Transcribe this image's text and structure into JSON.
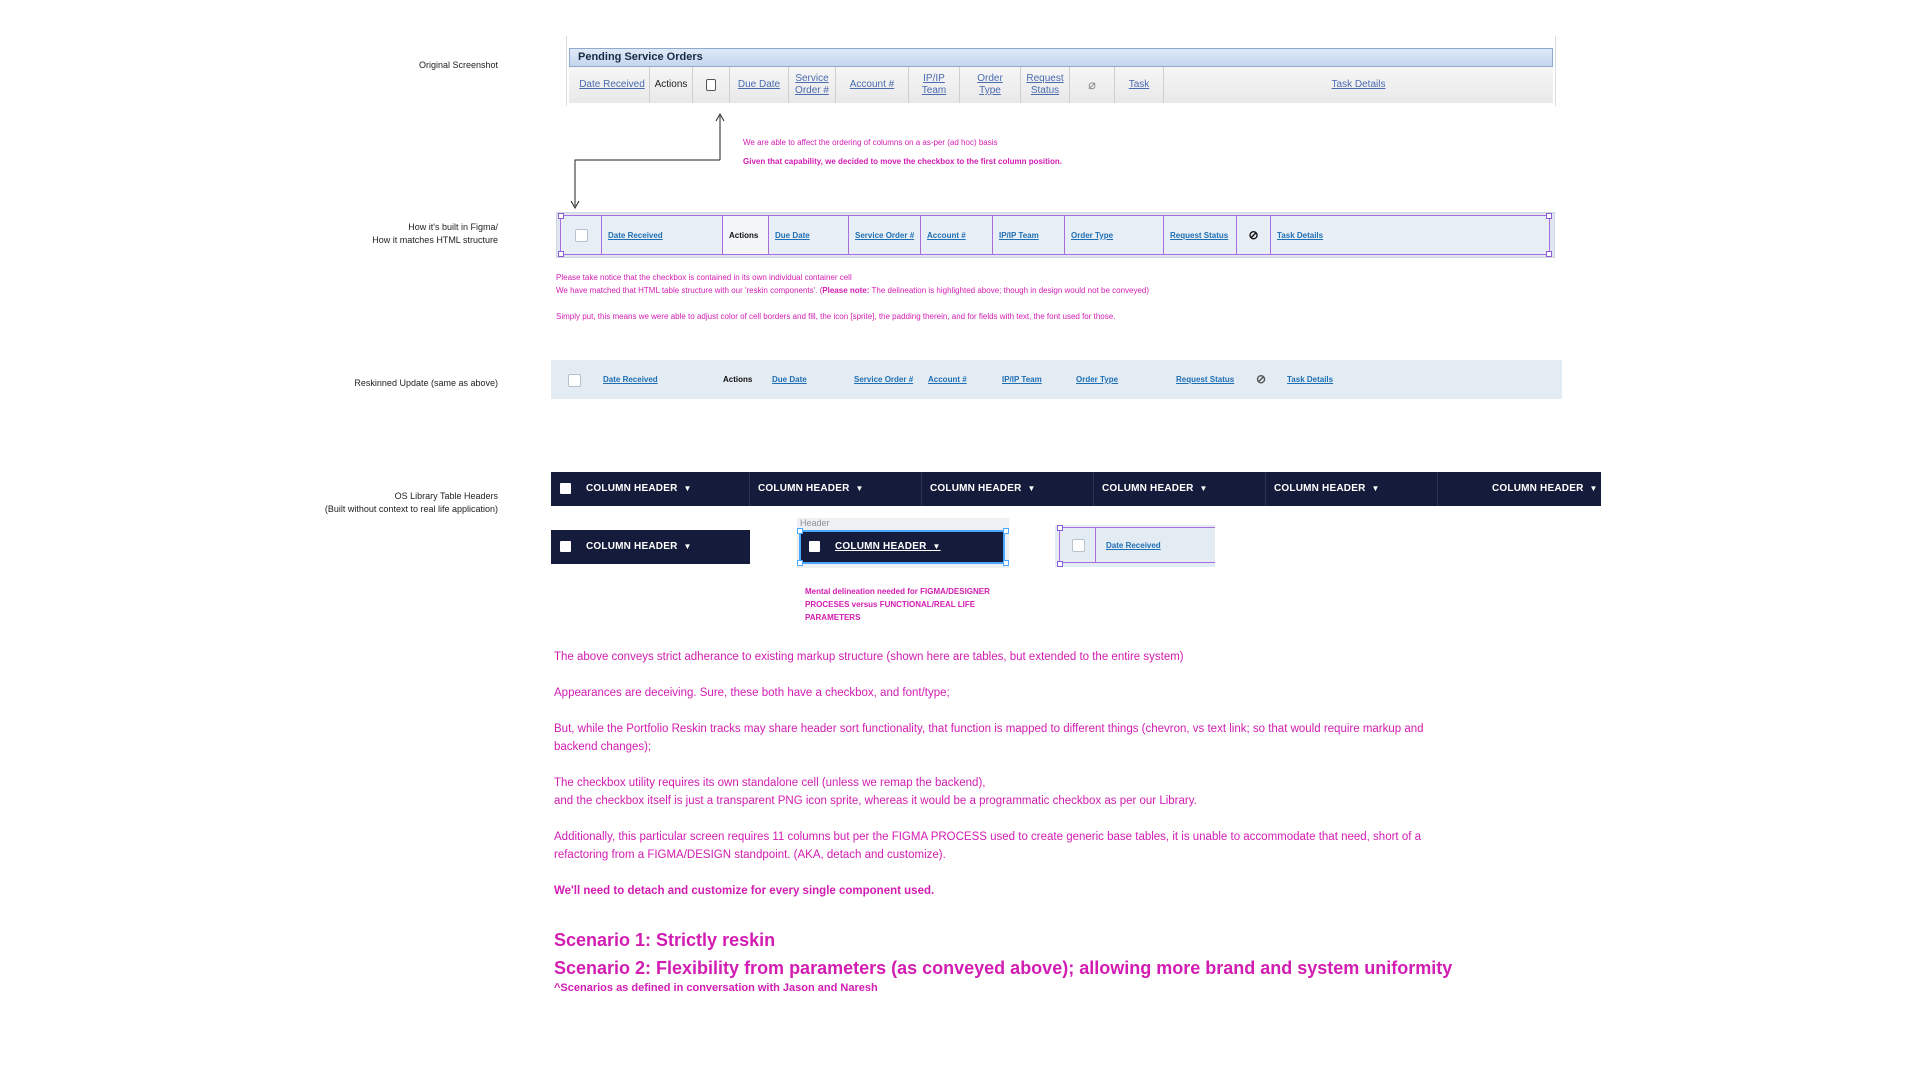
{
  "labels": {
    "original": "Original Screenshot",
    "figma_line1": "How it's built in Figma/",
    "figma_line2": "How it matches HTML structure",
    "reskinned": "Reskinned Update (same as above)",
    "os_line1": "OS Library Table Headers",
    "os_line2": "(Built without context to real life application)"
  },
  "original": {
    "title": "Pending Service Orders",
    "columns": [
      {
        "line1": "Date Received",
        "line2": ""
      },
      {
        "line1": "Actions",
        "line2": ""
      },
      {
        "line1": "",
        "line2": ""
      },
      {
        "line1": "Due Date",
        "line2": ""
      },
      {
        "line1": "Service",
        "line2": "Order #"
      },
      {
        "line1": "Account #",
        "line2": ""
      },
      {
        "line1": "IP/IP",
        "line2": "Team"
      },
      {
        "line1": "Order",
        "line2": "Type"
      },
      {
        "line1": "Request",
        "line2": "Status"
      },
      {
        "line1": "",
        "line2": ""
      },
      {
        "line1": "Task",
        "line2": ""
      },
      {
        "line1": "Task Details",
        "line2": ""
      }
    ]
  },
  "annotations": {
    "reorder_1": "We are able to affect the ordering of columns on a as-per (ad hoc) basis",
    "reorder_2": "Given that capability, we decided to move the checkbox to the first column position.",
    "notice_1": "Please take notice that the checkbox is contained in its own individual container cell",
    "notice_2a": "We have matched that HTML table structure with our 'reskin components'.  (",
    "notice_2b": "Please note:",
    "notice_2c": " The delineation is highlighted above; though in design would not be conveyed)",
    "notice_3": "Simply put, this means we were able to adjust color of cell borders and fill, the icon [sprite], the padding therein, and for fields with text, the font used for those.",
    "mental_1": "Mental delineation needed for FIGMA/DESIGNER",
    "mental_2": "PROCESES versus FUNCTIONAL/REAL LIFE",
    "mental_3": "PARAMETERS"
  },
  "figma_row": {
    "cols": [
      "",
      "Date Received",
      "Actions",
      "Due Date",
      "Service Order #",
      "Account #",
      "IP/IP Team",
      "Order Type",
      "Request Status",
      "",
      "Task Details"
    ]
  },
  "reskin_row": {
    "date_received": "Date Received",
    "actions": "Actions",
    "due_date": "Due Date",
    "service_order": "Service Order #",
    "account": "Account #",
    "ipip_team": "IP/IP Team",
    "order_type": "Order Type",
    "request_status": "Request Status",
    "task_details": "Task Details"
  },
  "os_library": {
    "header_label": "COLUMN HEADER",
    "header_small": "Header",
    "date_received": "Date Received",
    "chevron": "▼"
  },
  "body": {
    "p1": "The above conveys strict adherance to existing markup structure (shown here are tables, but extended to the entire system)",
    "p2": "Appearances are deceiving.   Sure, these both have a checkbox, and font/type;",
    "p3a": "But, while the Portfolio Reskin tracks may share header sort functionality, that function is mapped to different things (chevron, vs text link; so that would require markup and",
    "p3b": "backend changes);",
    "p4a": "The checkbox utility requires its own standalone cell (unless we remap the backend),",
    "p4b": "and the checkbox itself is just a transparent PNG icon sprite, whereas it would be a programmatic checkbox as per our Library.",
    "p5a": "Additionally, this particular screen requires 11 columns but per the FIGMA PROCESS used to create generic base tables, it is unable to accommodate that need, short of a",
    "p5b": "refactoring from a FIGMA/DESIGN standpoint.  (AKA, detach and customize).",
    "p6": "We'll need to detach and customize for every single component used.",
    "scenario1": "Scenario 1: Strictly reskin",
    "scenario2": "Scenario 2: Flexibility from parameters (as conveyed above); allowing more brand and system uniformity",
    "footnote": "^Scenarios as defined in conversation with Jason and Naresh"
  },
  "colors": {
    "annotation": "#d21cb2",
    "link_blue": "#1f6fb5",
    "navy": "#151b3a",
    "reskin_bg": "#e3ebf3",
    "figma_purple": "#a86ee0"
  }
}
